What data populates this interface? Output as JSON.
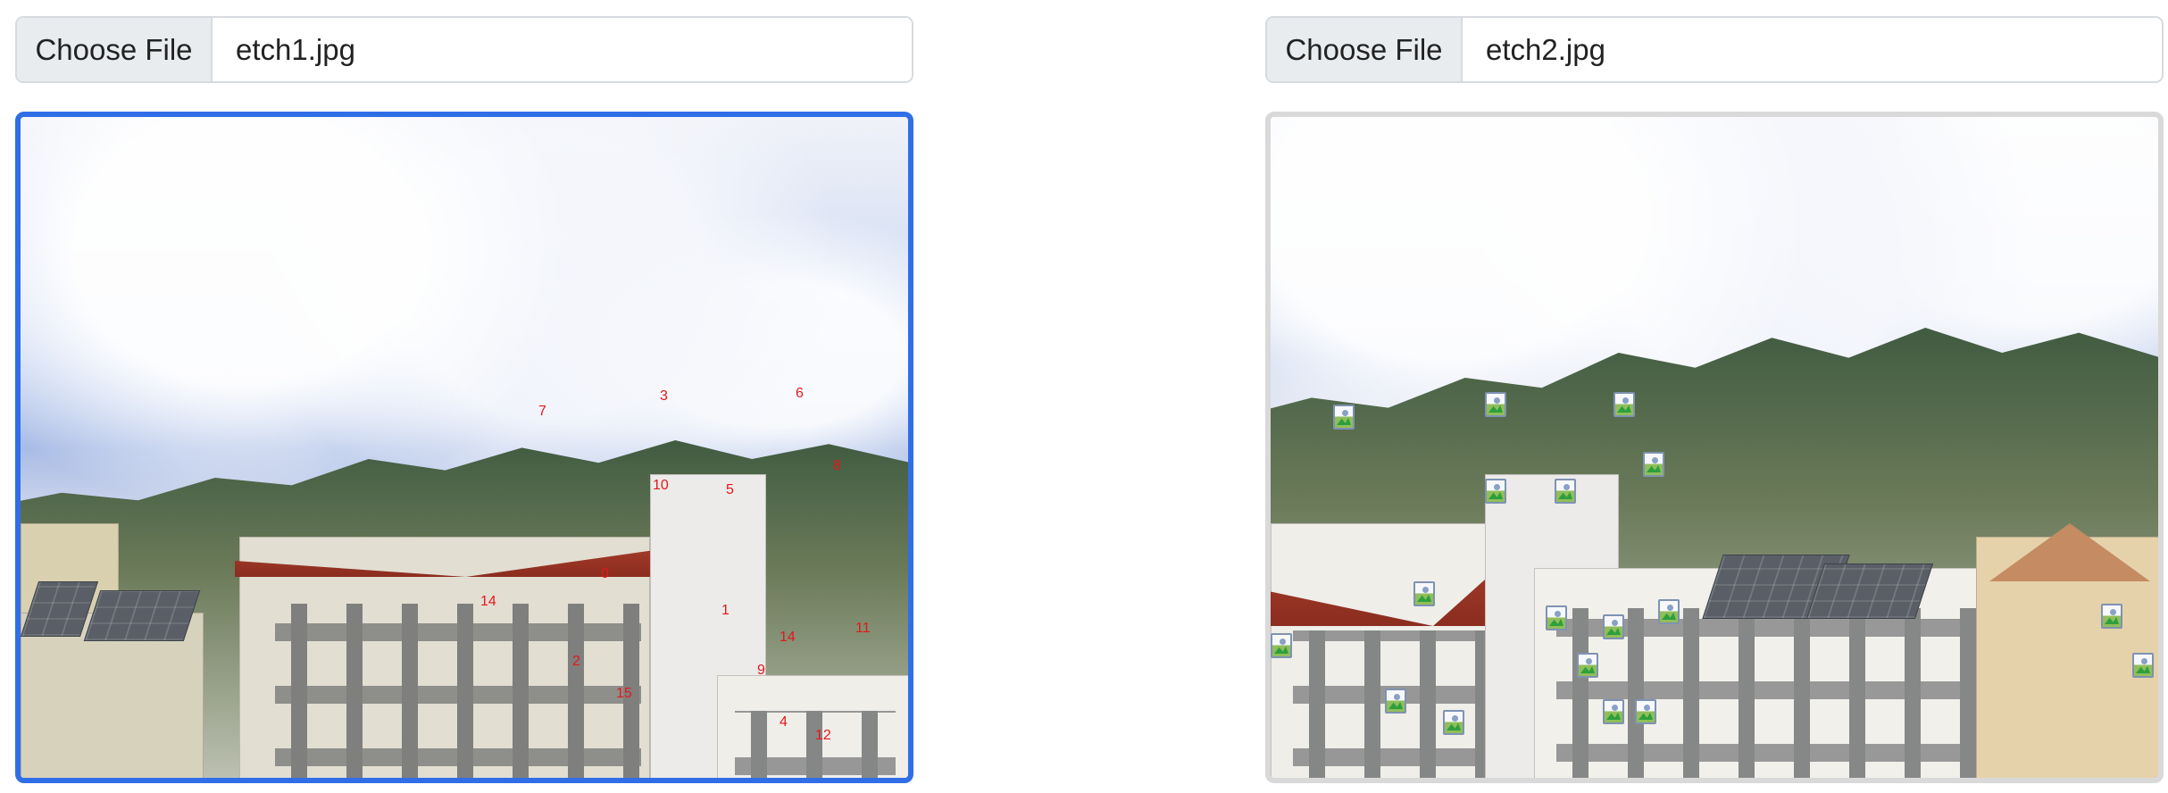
{
  "left_panel": {
    "button_label": "Choose File",
    "file_name": "etch1.jpg",
    "markers": [
      "7",
      "3",
      "6",
      "8",
      "10",
      "5",
      "0",
      "1",
      "14",
      "11",
      "2",
      "15",
      "9",
      "4",
      "12"
    ]
  },
  "right_panel": {
    "button_label": "Choose File",
    "file_name": "etch2.jpg",
    "thumbnail_icon_count": 18
  },
  "colors": {
    "selected_frame": "#2f6ee6",
    "unselected_frame": "#d9d9d9",
    "marker_text": "#e4171b"
  }
}
